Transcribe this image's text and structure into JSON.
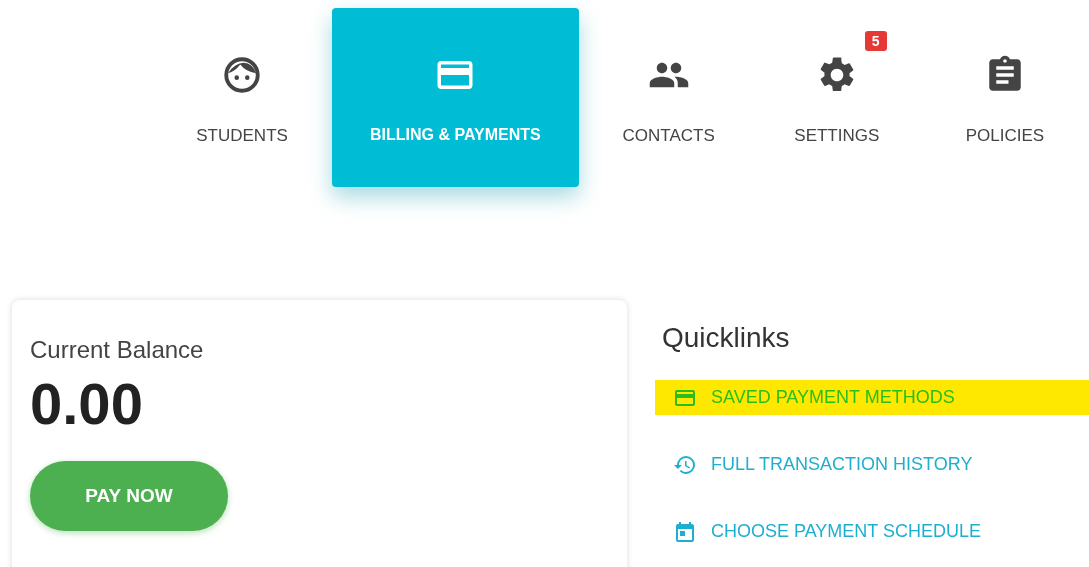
{
  "tabs": [
    {
      "label": "STUDENTS",
      "kind": "face",
      "selected": false
    },
    {
      "label": "BILLING & PAYMENTS",
      "kind": "card",
      "selected": true
    },
    {
      "label": "CONTACTS",
      "kind": "people",
      "selected": false
    },
    {
      "label": "SETTINGS",
      "kind": "gear",
      "selected": false,
      "badge": "5"
    },
    {
      "label": "POLICIES",
      "kind": "clipboard",
      "selected": false
    }
  ],
  "balance": {
    "label": "Current Balance",
    "amount": "0.00",
    "button": "PAY NOW"
  },
  "quicklinks": {
    "title": "Quicklinks",
    "links": [
      {
        "label": "SAVED PAYMENT METHODS",
        "kind": "card",
        "highlighted": true
      },
      {
        "label": "FULL TRANSACTION HISTORY",
        "kind": "history",
        "highlighted": false
      },
      {
        "label": "CHOOSE PAYMENT SCHEDULE",
        "kind": "calendar",
        "highlighted": false
      }
    ]
  }
}
